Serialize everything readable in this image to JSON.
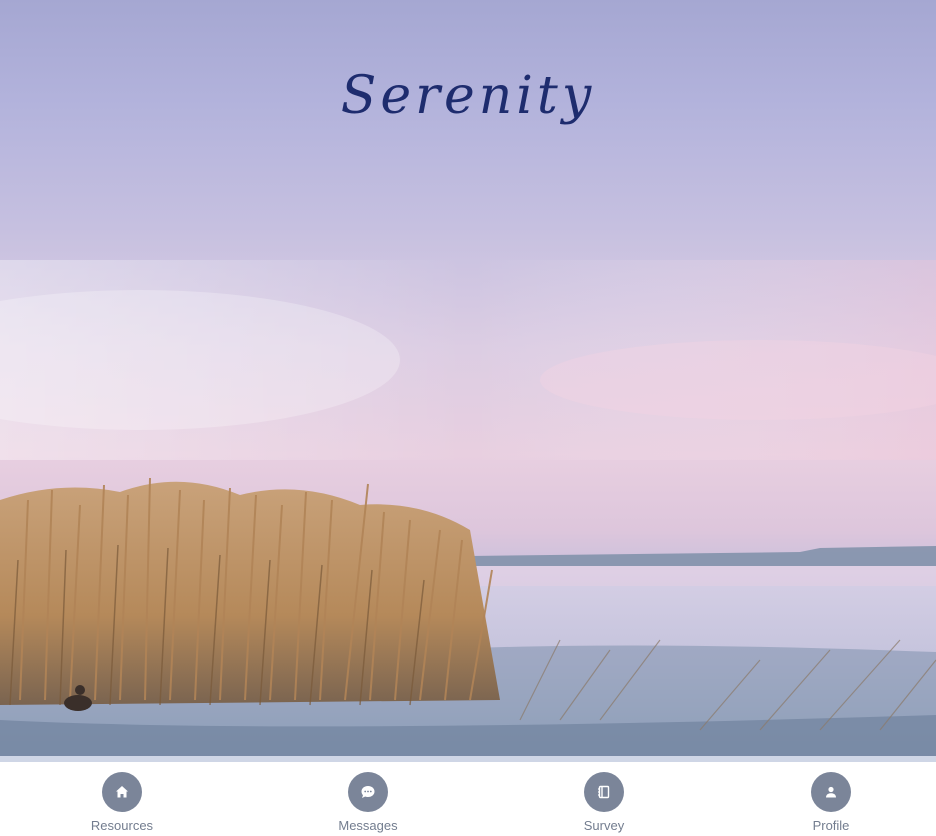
{
  "app": {
    "title": "Serenity"
  },
  "tabbar": {
    "tabs": [
      {
        "label": "Resources",
        "icon": "home-icon"
      },
      {
        "label": "Messages",
        "icon": "chat-bubble-icon"
      },
      {
        "label": "Survey",
        "icon": "notebook-icon"
      },
      {
        "label": "Profile",
        "icon": "person-icon"
      }
    ]
  },
  "colors": {
    "title": "#1e2c6e",
    "tab_icon_bg": "#7b8599",
    "tab_label": "#737d8f"
  }
}
